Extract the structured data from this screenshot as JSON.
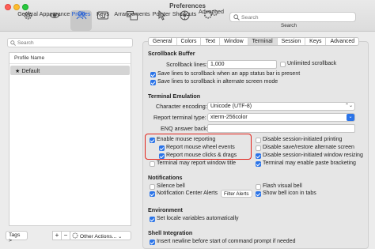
{
  "window": {
    "title": "Preferences"
  },
  "toolbar": {
    "items": [
      {
        "label": "General",
        "icon": "gear-icon"
      },
      {
        "label": "Appearance",
        "icon": "eye-icon"
      },
      {
        "label": "Profiles",
        "icon": "people-icon",
        "selected": true
      },
      {
        "label": "Keys",
        "icon": "keyboard-icon"
      },
      {
        "label": "Arrangements",
        "icon": "windows-icon"
      },
      {
        "label": "Pointer",
        "icon": "pointer-icon"
      },
      {
        "label": "Shortcuts",
        "icon": "shortcuts-icon"
      },
      {
        "label": "Advanced",
        "icon": "advanced-gear-icon"
      }
    ],
    "search_placeholder": "Search",
    "search_label": "Search"
  },
  "profiles": {
    "search_placeholder": "Search",
    "column_header": "Profile Name",
    "items": [
      {
        "name": "★ Default",
        "selected": true
      }
    ],
    "tags_label": "Tags >",
    "add_label": "+",
    "remove_label": "−",
    "other_actions_label": "Other Actions..."
  },
  "tabs": [
    "General",
    "Colors",
    "Text",
    "Window",
    "Terminal",
    "Session",
    "Keys",
    "Advanced"
  ],
  "selected_tab": "Terminal",
  "scrollback": {
    "heading": "Scrollback Buffer",
    "lines_label": "Scrollback lines:",
    "lines_value": "1,000",
    "unlimited_label": "Unlimited scrollback",
    "unlimited_checked": false,
    "save_statusbar_label": "Save lines to scrollback when an app status bar is present",
    "save_statusbar_checked": true,
    "save_alt_label": "Save lines to scrollback in alternate screen mode",
    "save_alt_checked": true
  },
  "emulation": {
    "heading": "Terminal Emulation",
    "encoding_label": "Character encoding:",
    "encoding_value": "Unicode (UTF-8)",
    "report_type_label": "Report terminal type:",
    "report_type_value": "xterm-256color",
    "enq_label": "ENQ answer back:",
    "enq_value": ""
  },
  "mouse": {
    "enable_reporting": "Enable mouse reporting",
    "report_wheel": "Report mouse wheel events",
    "report_clicks": "Report mouse clicks & drags",
    "report_title": "Terminal may report window title",
    "disable_printing": "Disable session-initiated printing",
    "disable_alt_screen": "Disable save/restore alternate screen",
    "disable_resizing": "Disable session-initiated window resizing",
    "enable_paste_bracketing": "Terminal may enable paste bracketing"
  },
  "notifications": {
    "heading": "Notifications",
    "silence_bell": "Silence bell",
    "flash_visual_bell": "Flash visual bell",
    "nc_alerts": "Notification Center Alerts",
    "filter_alerts": "Filter Alerts",
    "show_bell_icon": "Show bell icon in tabs"
  },
  "environment": {
    "heading": "Environment",
    "set_locale": "Set locale variables automatically"
  },
  "shell_integration": {
    "heading": "Shell Integration",
    "insert_newline": "Insert newline before start of command prompt if needed"
  },
  "colors": {
    "accent": "#2b74e8",
    "highlight_box": "#e2231a",
    "selected_toolbar_text": "#1f5cd6"
  }
}
